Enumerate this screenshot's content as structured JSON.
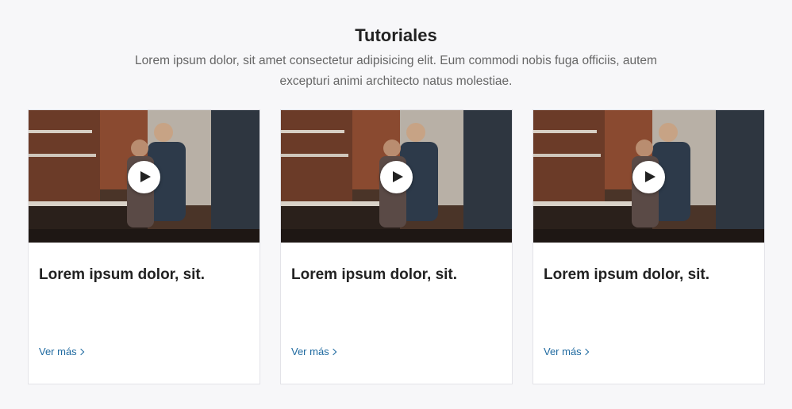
{
  "section": {
    "title": "Tutoriales",
    "subtitle": "Lorem ipsum dolor, sit amet consectetur adipisicing elit. Eum commodi nobis fuga officiis, autem excepturi animi architecto natus molestiae."
  },
  "cards": [
    {
      "title": "Lorem ipsum dolor, sit.",
      "link_label": "Ver más",
      "thumbnail_icon": "play-icon"
    },
    {
      "title": "Lorem ipsum dolor, sit.",
      "link_label": "Ver más",
      "thumbnail_icon": "play-icon"
    },
    {
      "title": "Lorem ipsum dolor, sit.",
      "link_label": "Ver más",
      "thumbnail_icon": "play-icon"
    }
  ],
  "colors": {
    "background": "#f7f7f9",
    "card_background": "#ffffff",
    "link": "#1f6aa0",
    "heading": "#222222"
  }
}
